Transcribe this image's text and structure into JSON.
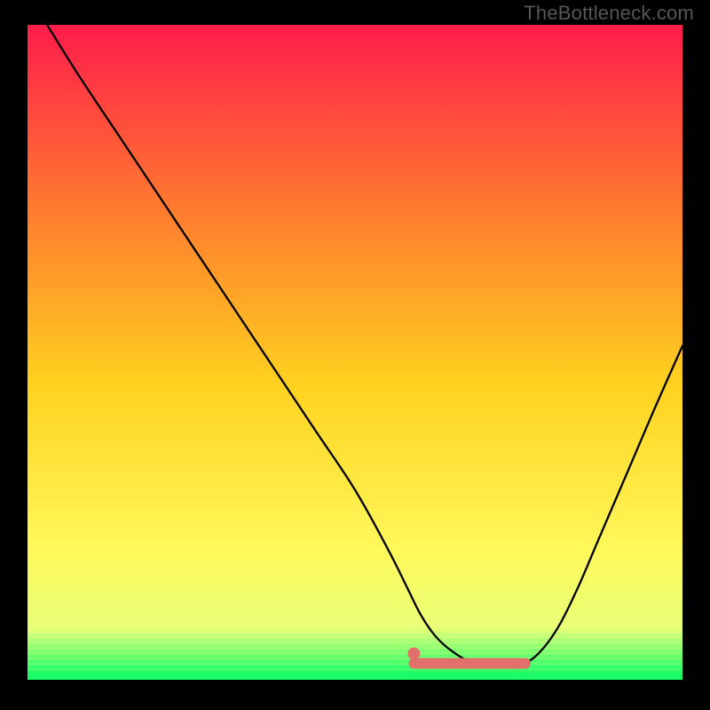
{
  "watermark": "TheBottleneck.com",
  "colors": {
    "background": "#000000",
    "gradient_top": "#ff1c4b",
    "gradient_mid_upper": "#ff7a2f",
    "gradient_mid": "#ffd21f",
    "gradient_mid_lower": "#fff85a",
    "gradient_lower": "#e9ff77",
    "gradient_bottom": "#1cff6b",
    "curve": "#000000",
    "marker": "#e36f6b",
    "watermark": "#555555"
  },
  "chart_data": {
    "type": "line",
    "title": "",
    "xlabel": "",
    "ylabel": "",
    "xlim": [
      0,
      100
    ],
    "ylim": [
      0,
      100
    ],
    "x": [
      0,
      3,
      8,
      14,
      20,
      26,
      32,
      38,
      44,
      50,
      55,
      58,
      60,
      62,
      64,
      67,
      70,
      73,
      75,
      78,
      81,
      84,
      87,
      90,
      93,
      96,
      100
    ],
    "values": [
      105,
      100,
      92,
      83,
      74,
      65,
      56,
      47,
      38,
      29,
      20,
      14,
      10,
      7,
      5,
      3,
      2,
      2,
      2,
      4,
      8,
      14,
      21,
      28,
      35,
      42,
      51
    ],
    "marker_segment": {
      "x_start": 59,
      "x_end": 76,
      "y": 2.5
    },
    "marker_dot": {
      "x": 59,
      "y": 4
    }
  }
}
